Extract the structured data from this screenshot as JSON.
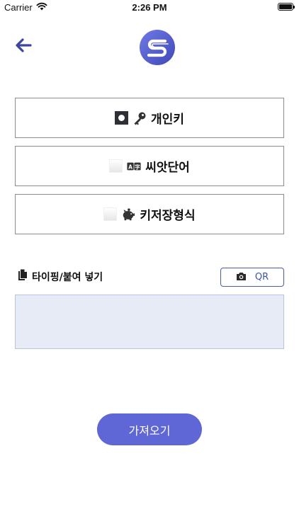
{
  "status_bar": {
    "carrier": "Carrier",
    "time": "2:26 PM",
    "battery_level": 1.0
  },
  "header": {
    "back_icon": "arrow-left-icon",
    "logo_icon": "app-logo-icon",
    "accent_color": "#3d45a0"
  },
  "options": [
    {
      "label": "개인키",
      "icon": "key-icon",
      "selected": true
    },
    {
      "label": "씨앗단어",
      "icon": "translate-icon",
      "selected": false
    },
    {
      "label": "키저장형식",
      "icon": "piggy-bank-icon",
      "selected": false
    }
  ],
  "input_section": {
    "label": "타이핑/붙여 넣기",
    "label_icon": "copy-icon",
    "qr_button_label": "QR",
    "qr_icon": "camera-icon",
    "value": "",
    "placeholder": ""
  },
  "import_button": {
    "label": "가져오기",
    "color": "#5f67d7"
  }
}
